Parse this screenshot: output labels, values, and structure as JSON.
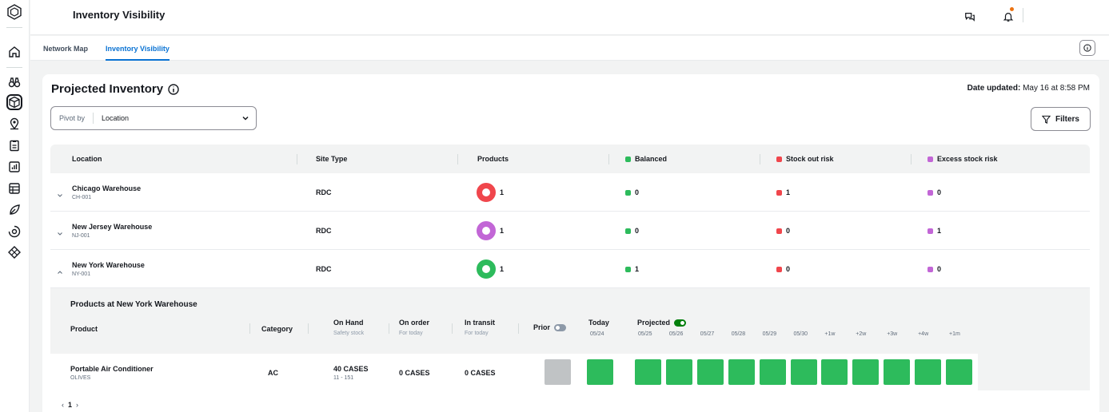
{
  "app": {
    "title": "Inventory Visibility"
  },
  "colors": {
    "balanced": "#2dbb5c",
    "stockout": "#f0464c",
    "excess": "#c266d6",
    "accent": "#0972d3"
  },
  "rail": {
    "icons": [
      "aws-supply-chain-logo-icon",
      "home-icon",
      "binoculars-icon",
      "cube-icon",
      "location-pin-icon",
      "clipboard-icon",
      "bar-chart-icon",
      "table-icon",
      "leaf-icon",
      "gear-cycle-icon",
      "diamond-icon"
    ]
  },
  "tabs": [
    {
      "label": "Network Map"
    },
    {
      "label": "Inventory Visibility"
    }
  ],
  "panel": {
    "title": "Projected Inventory",
    "updated_label": "Date updated:",
    "updated_value": "May 16 at 8:58 PM",
    "pivot_label": "Pivot by",
    "pivot_value": "Location",
    "filters_label": "Filters"
  },
  "table": {
    "headers": {
      "location": "Location",
      "site_type": "Site Type",
      "products": "Products",
      "balanced": "Balanced",
      "stockout": "Stock out risk",
      "excess": "Excess stock risk"
    },
    "rows": [
      {
        "name": "Chicago Warehouse",
        "id": "CH-001",
        "site_type": "RDC",
        "products": "1",
        "balanced": "0",
        "stockout": "1",
        "excess": "0",
        "ring": "stockout",
        "expanded": false
      },
      {
        "name": "New Jersey Warehouse",
        "id": "NJ-001",
        "site_type": "RDC",
        "products": "1",
        "balanced": "0",
        "stockout": "0",
        "excess": "1",
        "ring": "excess",
        "expanded": false
      },
      {
        "name": "New York Warehouse",
        "id": "NY-001",
        "site_type": "RDC",
        "products": "1",
        "balanced": "1",
        "stockout": "0",
        "excess": "0",
        "ring": "balanced",
        "expanded": true
      }
    ]
  },
  "detail": {
    "title": "Products at New York Warehouse",
    "headers": {
      "product": "Product",
      "category": "Category",
      "on_hand": "On Hand",
      "on_hand_sub": "Safety stock",
      "on_order": "On order",
      "on_order_sub": "For today",
      "in_transit": "In transit",
      "in_transit_sub": "For today",
      "prior": "Prior",
      "today": "Today",
      "today_date": "05/24",
      "projected": "Projected"
    },
    "dates": [
      "05/25",
      "05/26",
      "05/27",
      "05/28",
      "05/29",
      "05/30",
      "+1w",
      "+2w",
      "+3w",
      "+4w",
      "+1m"
    ],
    "product": {
      "name": "Portable Air Conditioner",
      "sub": "OLIVES",
      "category": "AC",
      "on_hand": "40 CASES",
      "safety": "11 - 151",
      "on_order": "0 CASES",
      "in_transit": "0 CASES"
    }
  },
  "pager": {
    "prev": "‹",
    "page": "1",
    "next": "›"
  }
}
